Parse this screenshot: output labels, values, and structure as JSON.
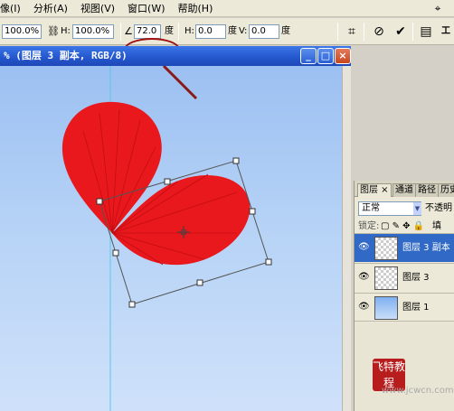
{
  "menu": {
    "items": [
      "像(I)",
      "分析(A)",
      "视图(V)",
      "窗口(W)",
      "帮助(H)"
    ],
    "right_icon": "transform-icon"
  },
  "options": {
    "width_value": "100.0%",
    "link_icon": "link-icon",
    "height_label": "H:",
    "height_value": "100.0%",
    "angle_icon": "angle-icon",
    "angle_value": "72.0",
    "angle_unit": "度",
    "skew_h_label": "H:",
    "skew_h_value": "0.0",
    "skew_h_unit": "度",
    "skew_v_label": "V:",
    "skew_v_value": "0.0",
    "skew_v_unit": "度",
    "warp_icon": "warp-icon",
    "cancel_icon": "cancel-icon",
    "commit_icon": "commit-icon",
    "palette_icon": "palette-icon",
    "tools_label": "工"
  },
  "document": {
    "title": "% (图层 3 副本, RGB/8)",
    "minimize": "_",
    "maximize": "□",
    "close": "×",
    "petal_color": "#e8181c"
  },
  "layers": {
    "tabs": [
      "图层 ×",
      "通道",
      "路径",
      "历史"
    ],
    "blend_mode": "正常",
    "opacity_label": "不透明",
    "lock_label": "锁定:",
    "fill_label": "填",
    "rows": [
      {
        "name": "图层 3 副本",
        "selected": true
      },
      {
        "name": "图层 3",
        "selected": false
      },
      {
        "name": "图层 1",
        "selected": false
      }
    ],
    "watermark": "飞特教程",
    "watermark_site": "www.jcwcn.com"
  }
}
